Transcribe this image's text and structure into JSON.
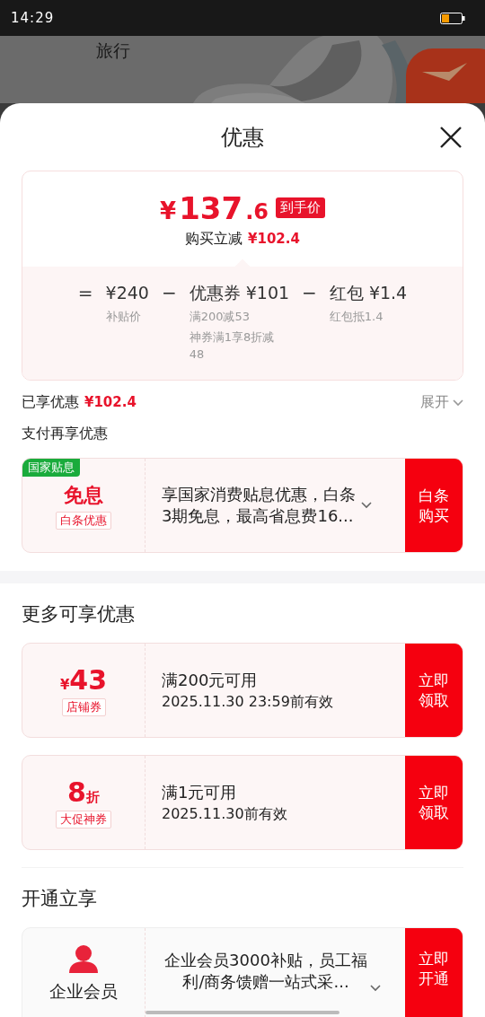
{
  "status_bar": {
    "time": "14:29"
  },
  "backdrop": {
    "caption": "旅行"
  },
  "sheet": {
    "title": "优惠"
  },
  "summary": {
    "currency": "¥",
    "price_integer": "137",
    "price_decimal": ".6",
    "price_tag": "到手价",
    "instant_label": "购买立减",
    "instant_amount": "¥102.4",
    "breakdown": [
      {
        "operator": "=",
        "amount": "¥240",
        "notes": [
          "补贴价"
        ]
      },
      {
        "operator": "−",
        "label": "优惠券",
        "amount": "¥101",
        "notes": [
          "满200减53",
          "神券满1享8折减48"
        ]
      },
      {
        "operator": "−",
        "label": "红包",
        "amount": "¥1.4",
        "notes": [
          "红包抵1.4"
        ]
      }
    ]
  },
  "enjoyed": {
    "label": "已享优惠",
    "amount": "¥102.4",
    "toggle": "展开",
    "expanded": false
  },
  "pay_section": {
    "title": "支付再享优惠",
    "offer": {
      "tag": "国家贴息",
      "headline": "免息",
      "subtag": "白条优惠",
      "description": "享国家消费贴息优惠，白条3期免息，最高省息费16...",
      "action": "白条购买"
    }
  },
  "more_section": {
    "title": "更多可享优惠",
    "coupons": [
      {
        "kind": "amount",
        "symbol": "¥",
        "value": "43",
        "label": "店铺券",
        "condition": "满200元可用",
        "validity": "2025.11.30 23:59前有效",
        "action": "立即领取"
      },
      {
        "kind": "discount",
        "symbol": "折",
        "value": "8",
        "label": "大促神券",
        "condition": "满1元可用",
        "validity": "2025.11.30前有效",
        "action": "立即领取"
      }
    ]
  },
  "membership_section": {
    "title": "开通立享",
    "offer": {
      "name": "企业会员",
      "description": "企业会员3000补贴，员工福利/商务馈赠一站式采...",
      "action": "立即开通"
    }
  }
}
